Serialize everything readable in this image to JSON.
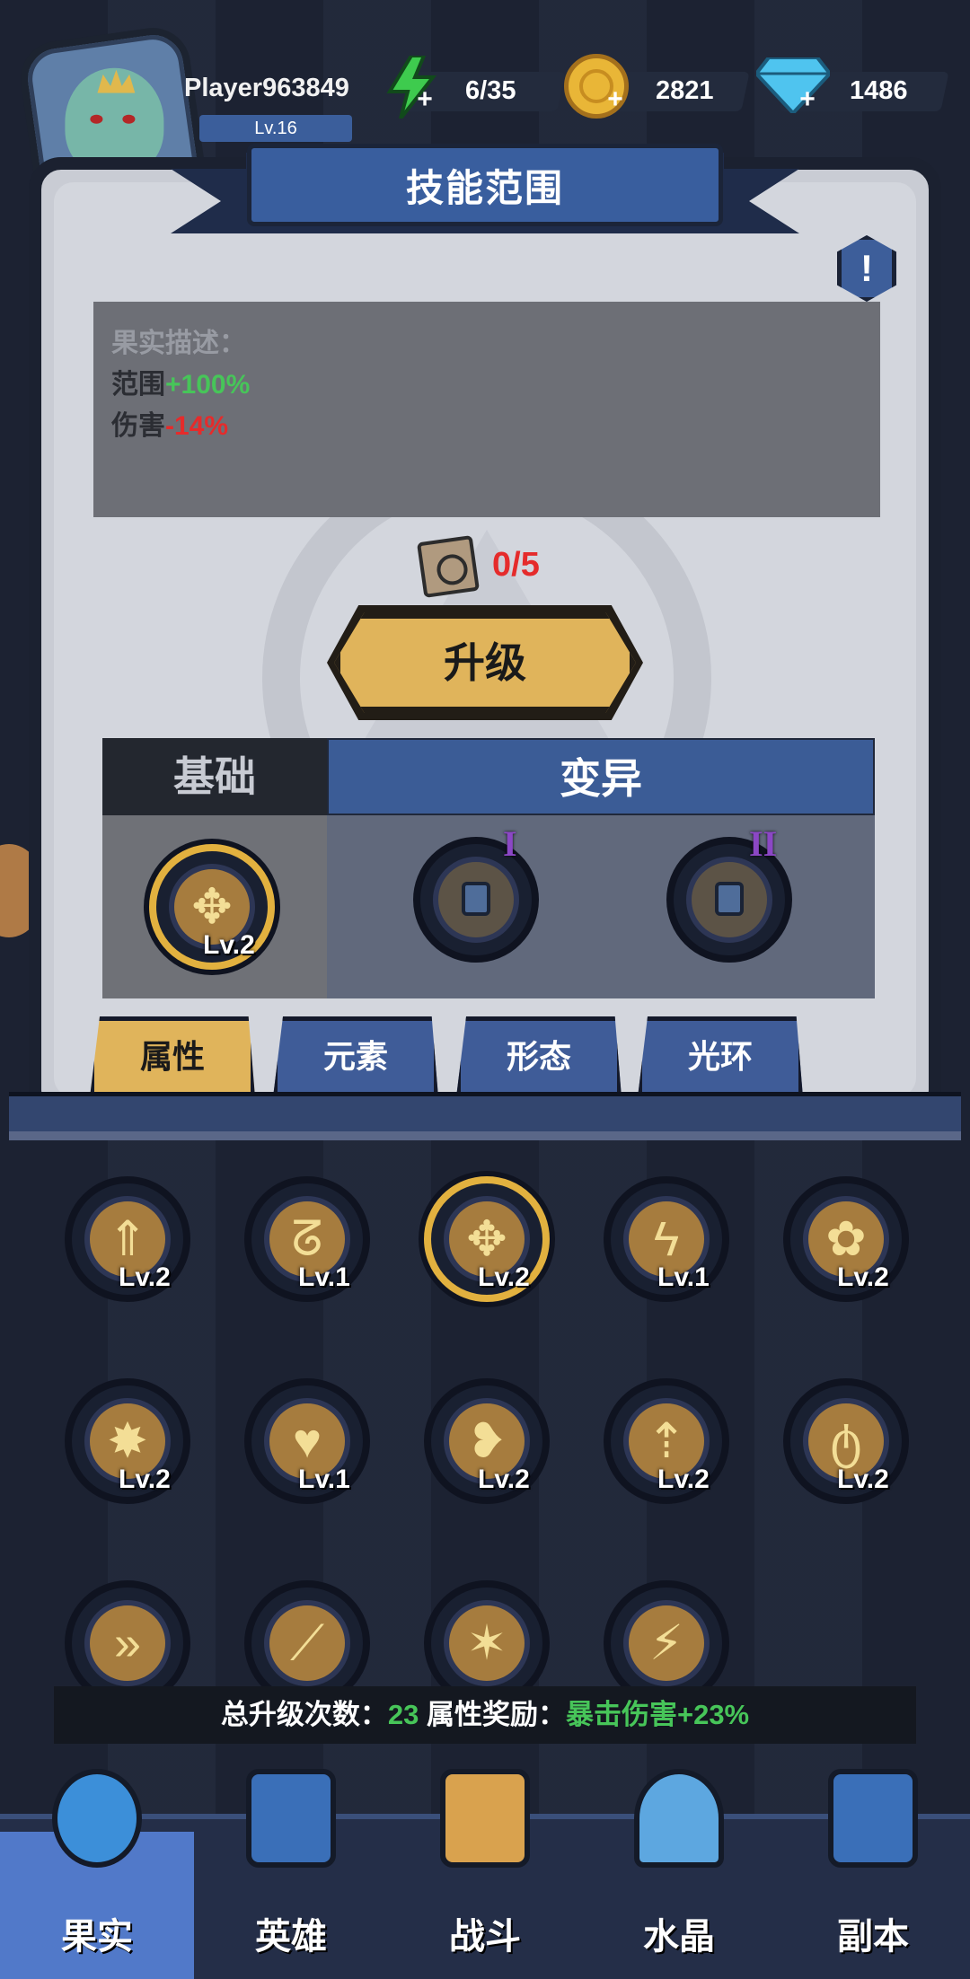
{
  "player": {
    "name": "Player963849",
    "level": "Lv.16"
  },
  "resources": {
    "energy": "6/35",
    "gold": "2821",
    "diamonds": "1486"
  },
  "title": "技能范围",
  "description": {
    "heading": "果实描述：",
    "lines": [
      {
        "label": "范围",
        "value": "+100%",
        "tone": "up"
      },
      {
        "label": "伤害",
        "value": "-14%",
        "tone": "down"
      }
    ]
  },
  "cost": "0/5",
  "upgrade_label": "升级",
  "tabs_section": {
    "base": "基础",
    "variant": "变异"
  },
  "base_skill": {
    "level": "Lv.2",
    "icon": "spread-arrows-icon"
  },
  "variants": [
    {
      "numeral": "I",
      "icon": "lock-icon"
    },
    {
      "numeral": "II",
      "icon": "lock-icon"
    }
  ],
  "categories": [
    {
      "label": "属性",
      "active": true
    },
    {
      "label": "元素",
      "active": false
    },
    {
      "label": "形态",
      "active": false
    },
    {
      "label": "光环",
      "active": false
    }
  ],
  "grid": [
    {
      "icon": "up-arrows-icon",
      "glyph": "⇑",
      "level": "Lv.2"
    },
    {
      "icon": "spiral-icon",
      "glyph": "ᘔ",
      "level": "Lv.1"
    },
    {
      "icon": "spread-arrows-icon",
      "glyph": "✥",
      "level": "Lv.2",
      "selected": true
    },
    {
      "icon": "lightning-icon",
      "glyph": "ϟ",
      "level": "Lv.1"
    },
    {
      "icon": "flower-icon",
      "glyph": "✿",
      "level": "Lv.2"
    },
    {
      "icon": "impact-icon",
      "glyph": "✸",
      "level": "Lv.2"
    },
    {
      "icon": "heart-icon",
      "glyph": "♥",
      "level": "Lv.1"
    },
    {
      "icon": "broken-heart-icon",
      "glyph": "❥",
      "level": "Lv.2"
    },
    {
      "icon": "ring-arrow-icon",
      "glyph": "⇡",
      "level": "Lv.2"
    },
    {
      "icon": "potion-icon",
      "glyph": "ტ",
      "level": "Lv.2"
    },
    {
      "icon": "chevrons-icon",
      "glyph": "»",
      "level": ""
    },
    {
      "icon": "slash-icon",
      "glyph": "⟋",
      "level": ""
    },
    {
      "icon": "burst-icon",
      "glyph": "✶",
      "level": ""
    },
    {
      "icon": "crack-icon",
      "glyph": "⚡",
      "level": ""
    }
  ],
  "summary": {
    "upgrades_label": "总升级次数：",
    "upgrades_value": "23",
    "bonus_label": "属性奖励：",
    "bonus_value": "暴击伤害+23%"
  },
  "nav": [
    {
      "label": "果实",
      "icon": "fruit-icon",
      "active": true
    },
    {
      "label": "英雄",
      "icon": "hero-icon",
      "active": false
    },
    {
      "label": "战斗",
      "icon": "battle-icon",
      "active": false
    },
    {
      "label": "水晶",
      "icon": "crystal-icon",
      "active": false
    },
    {
      "label": "副本",
      "icon": "dungeon-flag-icon",
      "active": false
    }
  ],
  "colors": {
    "accent_gold": "#e0b45b",
    "accent_blue": "#3b5c96",
    "positive": "#47c559",
    "negative": "#e52b2b"
  }
}
